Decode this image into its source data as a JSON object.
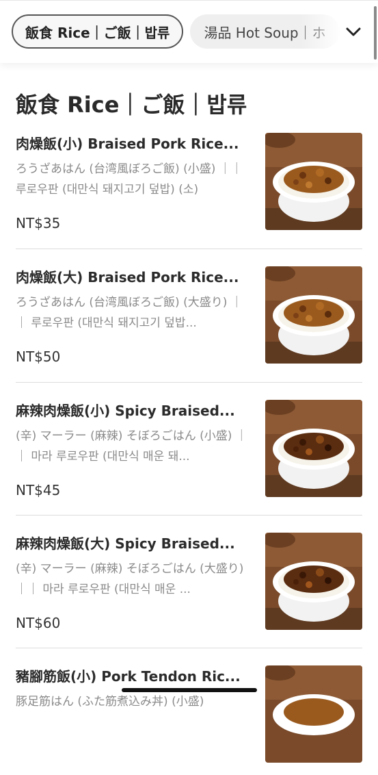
{
  "categories": [
    {
      "label": "飯食 Rice｜ご飯｜밥류",
      "active": true
    },
    {
      "label": "湯品 Hot Soup｜ホ",
      "active": false
    }
  ],
  "section": {
    "title": "飯食 Rice｜ご飯｜밥류"
  },
  "items": [
    {
      "name": "肉燥飯(小) Braised Pork Rice...",
      "desc": "ろうざあはん (台湾風ぼろご飯) (小盛) ｜｜ 루로우판 (대만식 돼지고기 덮밥) (소)",
      "price": "NT$35",
      "topping": "pork"
    },
    {
      "name": "肉燥飯(大) Braised Pork Rice...",
      "desc": "ろうざあはん (台湾風ぼろご飯) (大盛り) ｜｜ 루로우판 (대만식 돼지고기 덮밥...",
      "price": "NT$50",
      "topping": "pork"
    },
    {
      "name": "麻辣肉燥飯(小) Spicy Braised...",
      "desc": "(辛) マーラー (麻辣) そぼろごはん (小盛) ｜｜ 마라 루로우판 (대만식 매운 돼...",
      "price": "NT$45",
      "topping": "spicy"
    },
    {
      "name": "麻辣肉燥飯(大) Spicy Braised...",
      "desc": "(辛) マーラー (麻辣) そぼろごはん (大盛り) ｜｜ 마라 루로우판 (대만식 매운 ...",
      "price": "NT$60",
      "topping": "spicy"
    },
    {
      "name": "豬腳筋飯(小) Pork Tendon Ric...",
      "desc": "豚足筋はん (ふた筋煮込み丼) (小盛)",
      "price": "",
      "topping": "pork"
    }
  ],
  "colors": {
    "accent_border": "#555555",
    "chip_bg": "#efefef",
    "price": "#333333",
    "muted": "#8a8a8a"
  },
  "icons": {
    "chevron": "chevron-down-icon"
  }
}
